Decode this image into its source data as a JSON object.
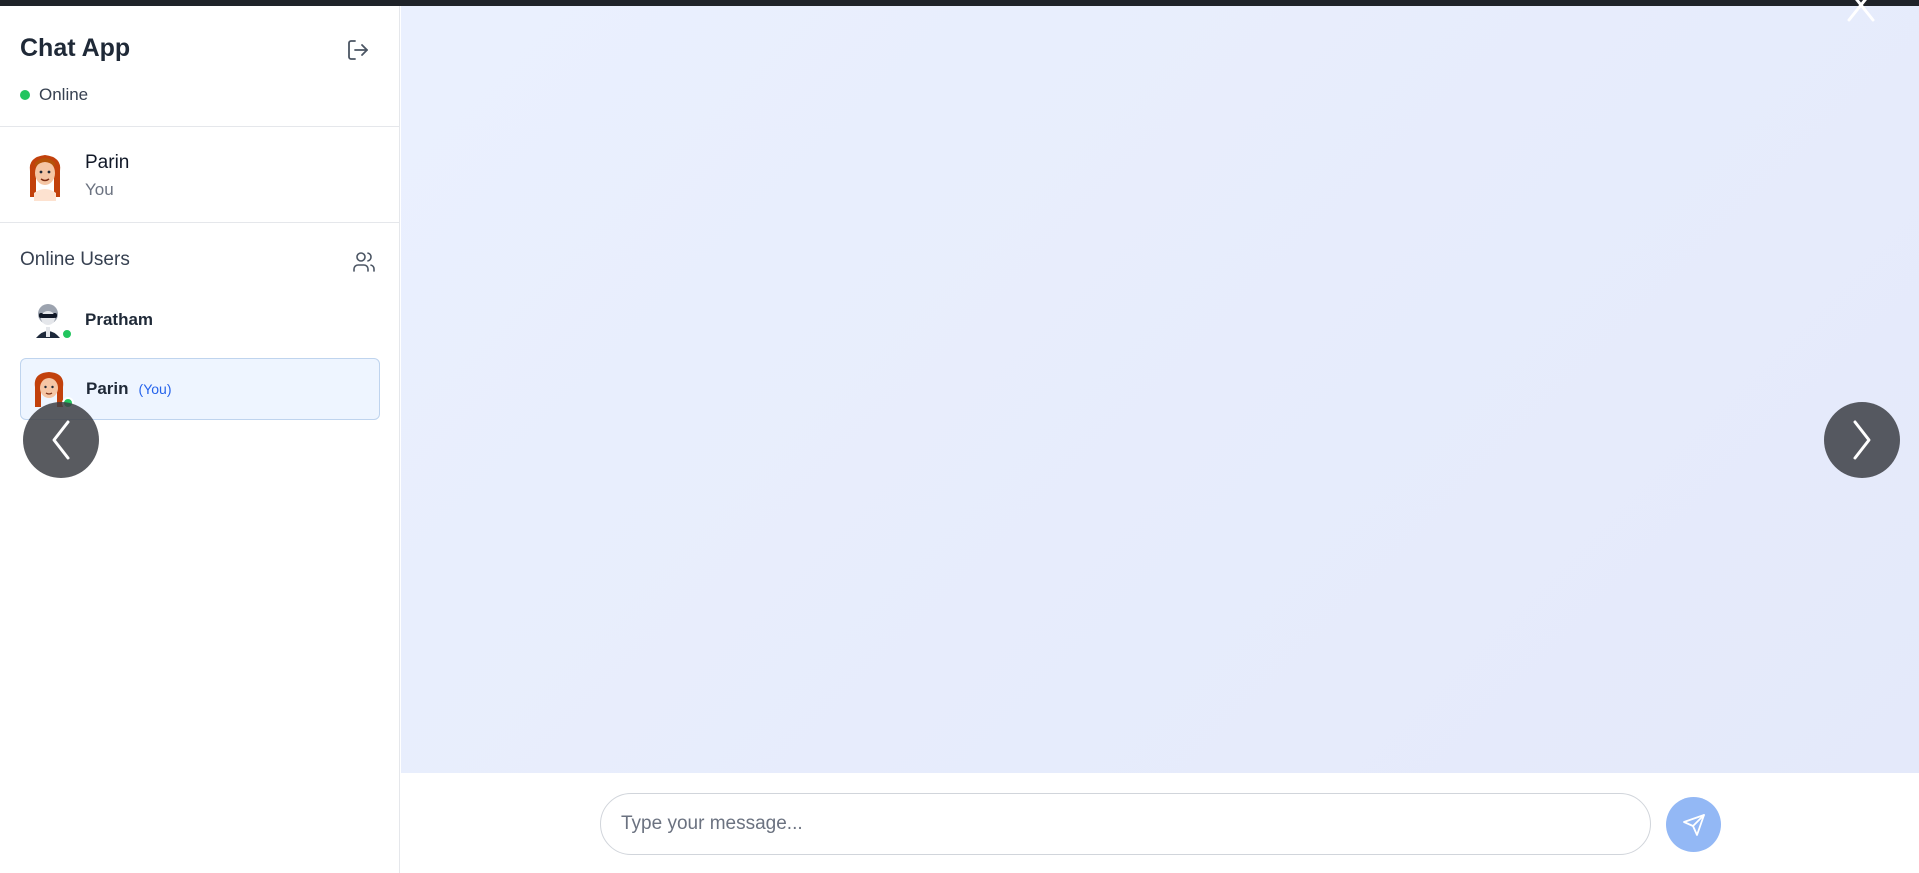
{
  "app": {
    "title": "Chat App",
    "status": "Online",
    "status_color": "#22c55e"
  },
  "current_user": {
    "name": "Parin",
    "subtitle": "You"
  },
  "online_users": {
    "title": "Online Users",
    "users": [
      {
        "name": "Pratham",
        "tag": "",
        "active": false,
        "online": true
      },
      {
        "name": "Parin",
        "tag": "(You)",
        "active": true,
        "online": true
      }
    ]
  },
  "composer": {
    "placeholder": "Type your message...",
    "value": ""
  },
  "colors": {
    "accent": "#2563eb",
    "send_button": "#93b8f5",
    "chat_background": "#e8eefd"
  },
  "icons": {
    "logout": "logout-icon",
    "users": "users-icon",
    "send": "send-icon",
    "prev": "chevron-left-icon",
    "next": "chevron-right-icon",
    "close": "close-icon"
  }
}
